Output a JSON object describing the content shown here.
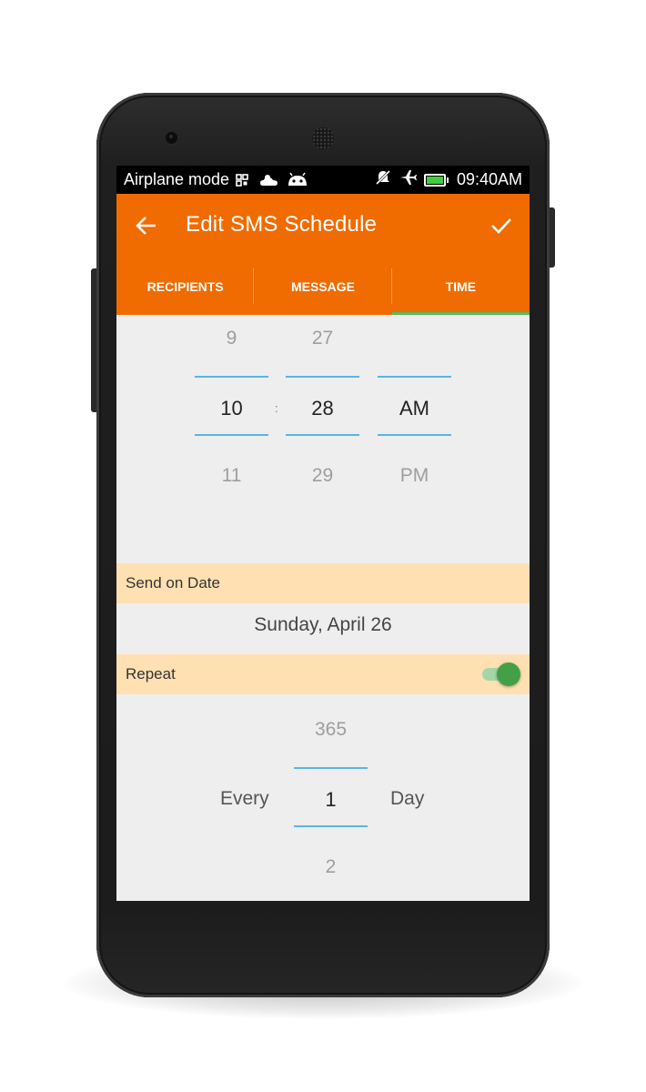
{
  "status_bar": {
    "mode_text": "Airplane mode",
    "time": "09:40AM",
    "icons": [
      "screenshot-icon",
      "weather-cloud-icon",
      "android-icon",
      "mute-icon",
      "airplane-icon",
      "battery-icon"
    ]
  },
  "app_bar": {
    "title": "Edit SMS Schedule",
    "back_icon": "arrow-left-icon",
    "save_icon": "check-icon"
  },
  "tabs": [
    {
      "label": "RECIPIENTS",
      "active": false
    },
    {
      "label": "MESSAGE",
      "active": false
    },
    {
      "label": "TIME",
      "active": true
    }
  ],
  "time_picker": {
    "hour": {
      "prev": "9",
      "selected": "10",
      "next": "11"
    },
    "minute": {
      "prev": "27",
      "selected": "28",
      "next": "29"
    },
    "ampm": {
      "prev": "",
      "selected": "AM",
      "next": "PM"
    },
    "separator": ":"
  },
  "send_on": {
    "label": "Send on Date",
    "value": "Sunday, April 26"
  },
  "repeat": {
    "label": "Repeat",
    "enabled": true,
    "prefix": "Every",
    "interval": {
      "prev": "365",
      "selected": "1",
      "next": "2"
    },
    "unit": "Day"
  },
  "colors": {
    "primary": "#f06b00",
    "tab_indicator": "#5cb85c",
    "section_bg": "#ffe0b2",
    "picker_line": "#5ab4e6",
    "toggle_on": "#43a047"
  }
}
